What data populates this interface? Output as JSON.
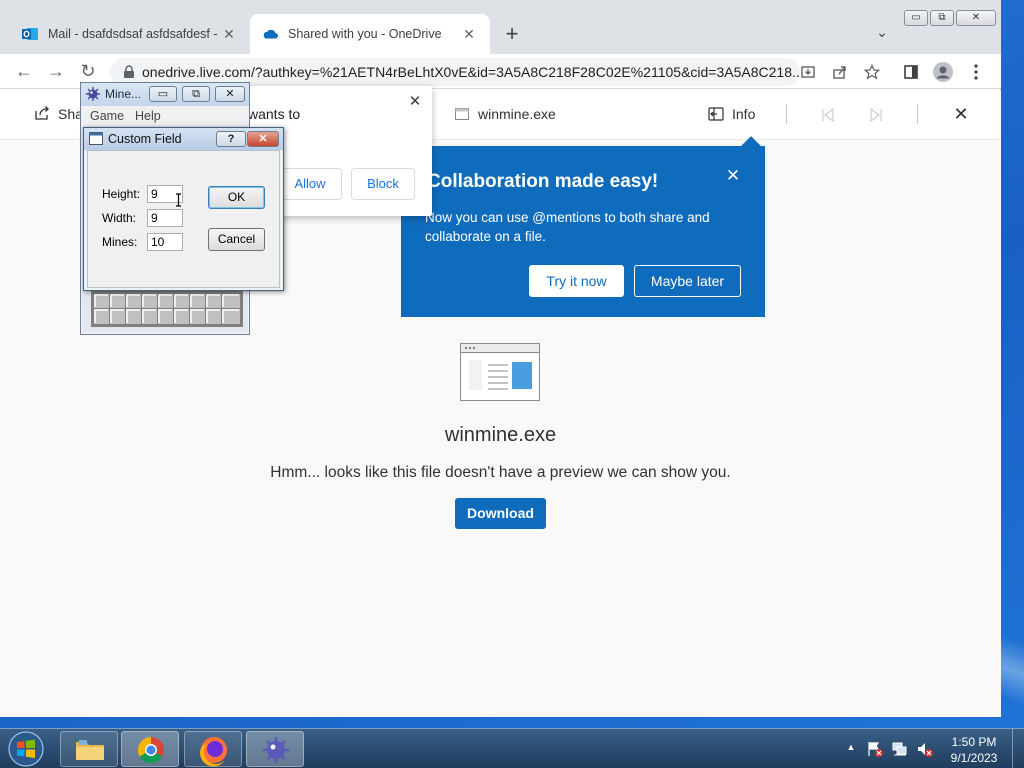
{
  "browser": {
    "tabs": [
      {
        "title": "Mail - dsafdsdsaf asfdsafdesf - O",
        "close": "✕"
      },
      {
        "title": "Shared with you - OneDrive",
        "close": "✕"
      }
    ],
    "new_tab": "+",
    "tab_dropdown": "⌄",
    "window_controls": {
      "minimize": "▭",
      "restore": "⧉",
      "close": "✕"
    },
    "nav": {
      "back": "←",
      "forward": "→",
      "reload": "↻"
    },
    "url": "onedrive.live.com/?authkey=%21AETN4rBeLhtX0vE&id=3A5A8C218F28C02E%21105&cid=3A5A8C218..."
  },
  "onedrive": {
    "share_label": "Sha",
    "file_name_header": "winmine.exe",
    "info_label": "Info",
    "close": "✕",
    "file_name": "winmine.exe",
    "no_preview_message": "Hmm... looks like this file doesn't have a preview we can show you.",
    "download_label": "Download"
  },
  "permission_popup": {
    "text": "wants to",
    "close": "✕",
    "allow_label": "Allow",
    "block_label": "Block"
  },
  "callout": {
    "title": "Collaboration made easy!",
    "body": "Now you can use @mentions to both share and collaborate on a file.",
    "try_label": "Try it now",
    "later_label": "Maybe later",
    "close": "✕"
  },
  "minesweeper": {
    "title": "Mine...",
    "menu": [
      "Game",
      "Help"
    ],
    "controls": {
      "minimize": "▭",
      "restore": "⧉",
      "close": "✕"
    }
  },
  "custom_field": {
    "title": "Custom Field",
    "help": "?",
    "close": "✕",
    "height_label": "Height:",
    "height_value": "9",
    "width_label": "Width:",
    "width_value": "9",
    "mines_label": "Mines:",
    "mines_value": "10",
    "ok_label": "OK",
    "cancel_label": "Cancel"
  },
  "taskbar": {
    "time": "1:50 PM",
    "date": "9/1/2023",
    "tray_arrow": "▲"
  },
  "colors": {
    "onedrive_blue": "#0f6cbd",
    "chrome_tabstrip": "#dee1e6",
    "desktop_blue": "#1e6fd9"
  }
}
